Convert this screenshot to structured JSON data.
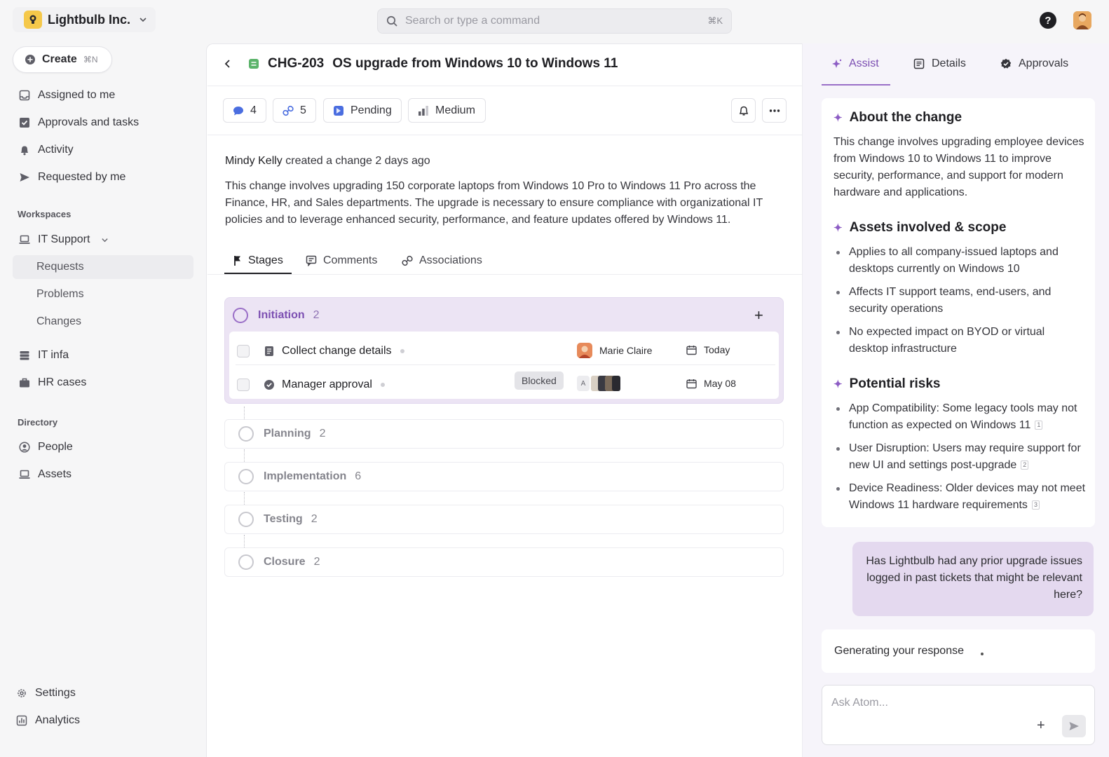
{
  "org": {
    "name": "Lightbulb Inc."
  },
  "search": {
    "placeholder": "Search or type a command",
    "shortcut": "⌘K"
  },
  "sidebar": {
    "create": {
      "label": "Create",
      "shortcut": "⌘N"
    },
    "items": [
      {
        "label": "Assigned to me",
        "icon": "inbox-icon"
      },
      {
        "label": "Approvals and tasks",
        "icon": "checkbox-icon"
      },
      {
        "label": "Activity",
        "icon": "bell-icon"
      },
      {
        "label": "Requested by me",
        "icon": "send-icon"
      }
    ],
    "workspaces_heading": "Workspaces",
    "workspace": {
      "label": "IT Support",
      "icon": "laptop-icon"
    },
    "workspace_items": [
      {
        "label": "Requests"
      },
      {
        "label": "Problems"
      },
      {
        "label": "Changes"
      }
    ],
    "other_workspaces": [
      {
        "label": "IT infa",
        "icon": "server-icon"
      },
      {
        "label": "HR cases",
        "icon": "briefcase-icon"
      }
    ],
    "directory_heading": "Directory",
    "directory_items": [
      {
        "label": "People",
        "icon": "person-icon"
      },
      {
        "label": "Assets",
        "icon": "laptop-icon"
      }
    ],
    "footer_items": [
      {
        "label": "Settings",
        "icon": "gear-icon"
      },
      {
        "label": "Analytics",
        "icon": "chart-icon"
      }
    ]
  },
  "ticket": {
    "id": "CHG-203",
    "title": "OS upgrade from Windows 10 to Windows 11",
    "chips": {
      "comments": "4",
      "links": "5",
      "status": "Pending",
      "priority": "Medium"
    },
    "activity_author": "Mindy Kelly",
    "activity_text": "created a change 2 days ago",
    "description": "This change involves upgrading 150 corporate laptops from Windows 10 Pro to Windows 11 Pro across the Finance, HR, and Sales departments. The upgrade is necessary to ensure compliance with organizational IT policies and to leverage enhanced security, performance, and feature updates offered by Windows 11.",
    "tabs": [
      "Stages",
      "Comments",
      "Associations"
    ]
  },
  "stages": {
    "initiation": {
      "name": "Initiation",
      "count": "2"
    },
    "tasks": [
      {
        "name": "Collect change details",
        "assignee": "Marie Claire",
        "date": "Today"
      },
      {
        "name": "Manager approval",
        "badge": "Blocked",
        "avatar_initial": "A",
        "date": "May 08"
      }
    ],
    "others": [
      {
        "name": "Planning",
        "count": "2"
      },
      {
        "name": "Implementation",
        "count": "6"
      },
      {
        "name": "Testing",
        "count": "2"
      },
      {
        "name": "Closure",
        "count": "2"
      }
    ]
  },
  "assist": {
    "tabs": [
      "Assist",
      "Details",
      "Approvals"
    ],
    "about_title": "About the change",
    "about_body": "This change involves upgrading employee devices from Windows 10 to Windows 11 to improve security, performance, and support for modern hardware and applications.",
    "assets_title": "Assets involved & scope",
    "assets_bullets": [
      "Applies to all company-issued laptops and desktops currently on Windows 10",
      "Affects IT support teams, end-users, and security operations",
      "No expected impact on BYOD or virtual desktop infrastructure"
    ],
    "risks_title": "Potential risks",
    "risks_bullets": [
      "App Compatibility: Some legacy tools may not function as expected on Windows 11",
      "User Disruption: Users may require support for new UI and settings post-upgrade",
      "Device Readiness: Older devices may not meet Windows 11 hardware requirements"
    ],
    "citations": [
      "1",
      "2",
      "3"
    ],
    "user_message": "Has Lightbulb had any prior upgrade issues logged in past tickets that might be relevant here?",
    "generating": "Generating your response",
    "ask_placeholder": "Ask Atom..."
  },
  "colors": {
    "accent": "#7c4fb2",
    "stage_bg": "#ece4f4",
    "bubble": "#e4d9ef"
  }
}
